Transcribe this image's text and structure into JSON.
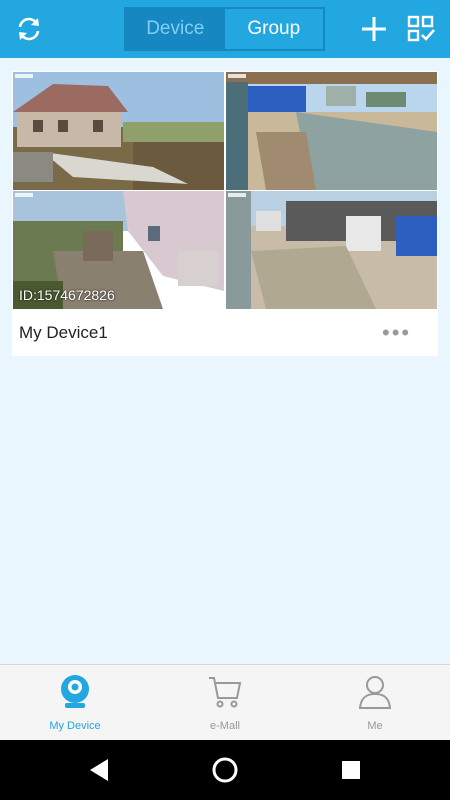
{
  "header": {
    "tabs": [
      {
        "label": "Device",
        "active": true
      },
      {
        "label": "Group",
        "active": false
      }
    ],
    "icons": [
      "refresh-icon",
      "add-icon",
      "select-icon"
    ]
  },
  "device": {
    "name": "My Device1",
    "id_label": "ID:1574672826",
    "more_label": "•••"
  },
  "bottom_nav": [
    {
      "label": "My Device",
      "icon": "camera-icon",
      "active": true
    },
    {
      "label": "e-Mall",
      "icon": "cart-icon",
      "active": false
    },
    {
      "label": "Me",
      "icon": "person-icon",
      "active": false
    }
  ],
  "colors": {
    "accent": "#22a7e0",
    "page_background": "#eaf6fd"
  }
}
